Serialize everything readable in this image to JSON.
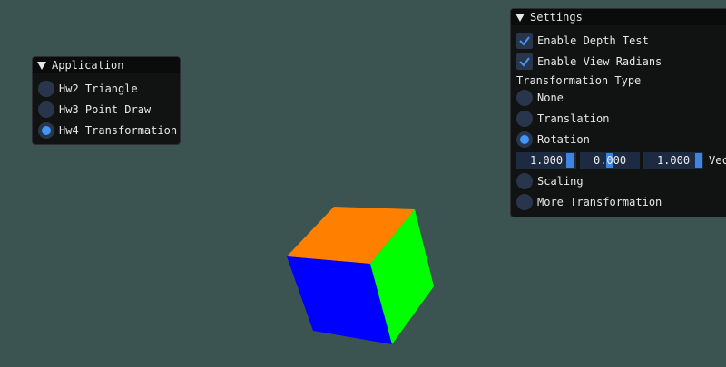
{
  "application_panel": {
    "title": "Application",
    "items": [
      {
        "label": "Hw2 Triangle",
        "selected": false
      },
      {
        "label": "Hw3 Point Draw",
        "selected": false
      },
      {
        "label": "Hw4 Transformation",
        "selected": true
      }
    ]
  },
  "settings_panel": {
    "title": "Settings",
    "checkboxes": [
      {
        "label": "Enable Depth Test",
        "checked": true
      },
      {
        "label": "Enable View Radians",
        "checked": true
      }
    ],
    "transformation_type_label": "Transformation Type",
    "transformation_options": [
      {
        "label": "None",
        "selected": false
      },
      {
        "label": "Translation",
        "selected": false
      },
      {
        "label": "Rotation",
        "selected": true
      }
    ],
    "rotation_vector": {
      "values": [
        "1.000",
        "0.000",
        "1.000"
      ],
      "label": "Vec"
    },
    "more_options": [
      {
        "label": "Scaling",
        "selected": false
      },
      {
        "label": "More Transformation",
        "selected": false
      }
    ]
  },
  "scene": {
    "cube_face_colors": {
      "top": "#ff8000",
      "front": "#0000ff",
      "side": "#00ff00"
    },
    "background": "#3b5452"
  },
  "theme": {
    "accent": "#4296fa",
    "frame_bg": "#29354a"
  }
}
